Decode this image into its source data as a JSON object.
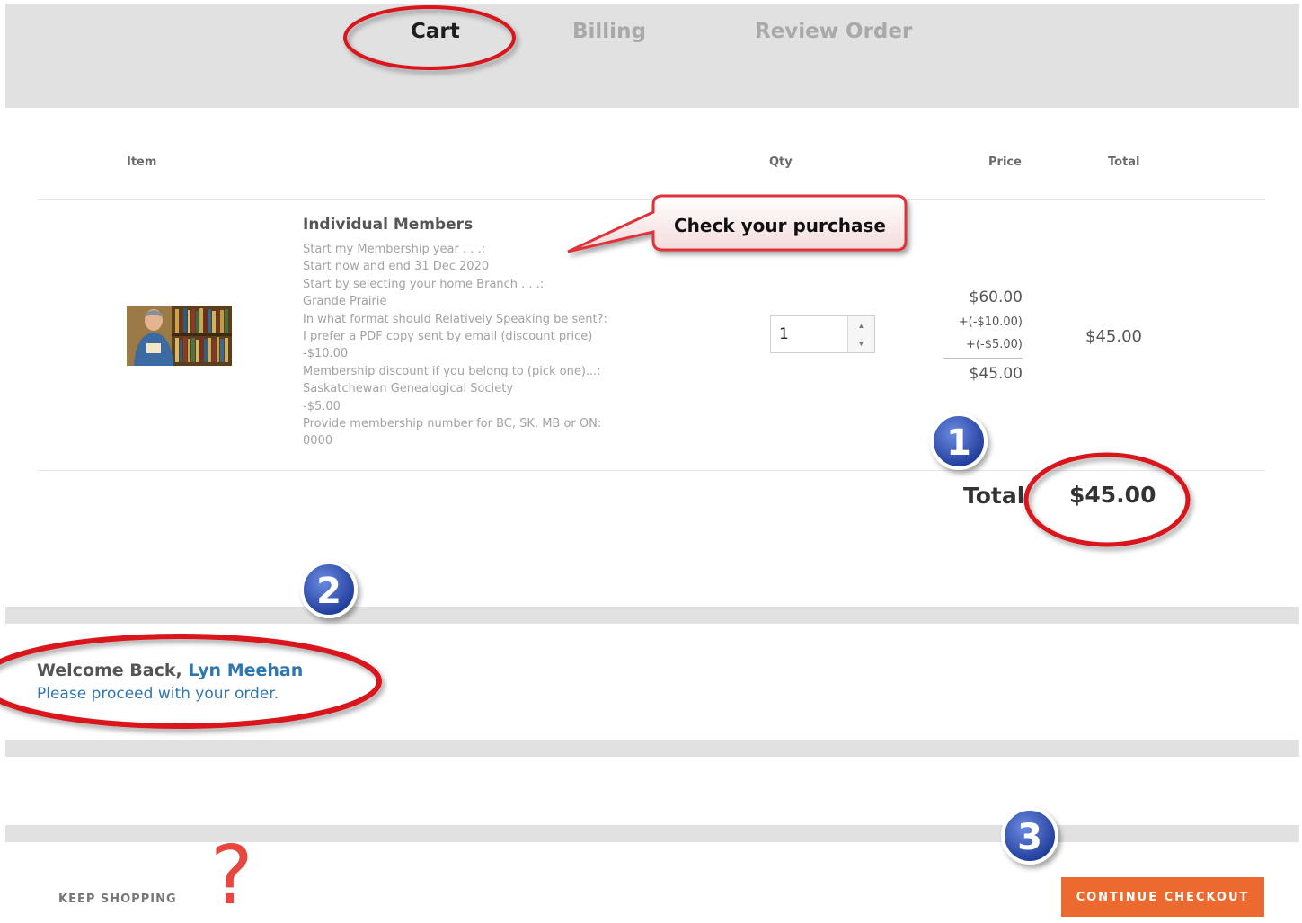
{
  "steps": [
    {
      "label": "Cart",
      "active": true
    },
    {
      "label": "Billing",
      "active": false
    },
    {
      "label": "Review Order",
      "active": false
    }
  ],
  "table": {
    "headers": {
      "item": "Item",
      "qty": "Qty",
      "price": "Price",
      "total": "Total"
    }
  },
  "cart_item": {
    "title": "Individual Members",
    "options": [
      "Start my Membership year . . .:",
      "Start now and end 31 Dec 2020",
      "Start by selecting your home Branch . . .:",
      "Grande Prairie",
      "In what format should Relatively Speaking be sent?:",
      "I prefer a PDF copy sent by email (discount price)",
      "-$10.00",
      "Membership discount if you belong to (pick one)...:",
      "Saskatchewan Genealogical Society",
      "-$5.00",
      "Provide membership number for BC, SK, MB or ON:",
      "0000"
    ],
    "qty": "1",
    "price_base": "$60.00",
    "price_adjust_1": "+(-$10.00)",
    "price_adjust_2": "+(-$5.00)",
    "price_final": "$45.00",
    "line_total": "$45.00"
  },
  "cart_total": {
    "label": "Total",
    "value": "$45.00"
  },
  "welcome": {
    "greeting": "Welcome Back,",
    "name": "Lyn Meehan",
    "message": "Please proceed with your order."
  },
  "actions": {
    "keep_shopping": "KEEP SHOPPING",
    "continue_checkout": "CONTINUE CHECKOUT"
  },
  "annotations": {
    "callout": "Check your purchase",
    "badges": [
      "1",
      "2",
      "3"
    ],
    "question_mark": "?",
    "colors": {
      "circle": "#d8121b",
      "badge": "#2a47a8",
      "accent": "#ec6a2f",
      "link": "#2e76b0"
    }
  }
}
